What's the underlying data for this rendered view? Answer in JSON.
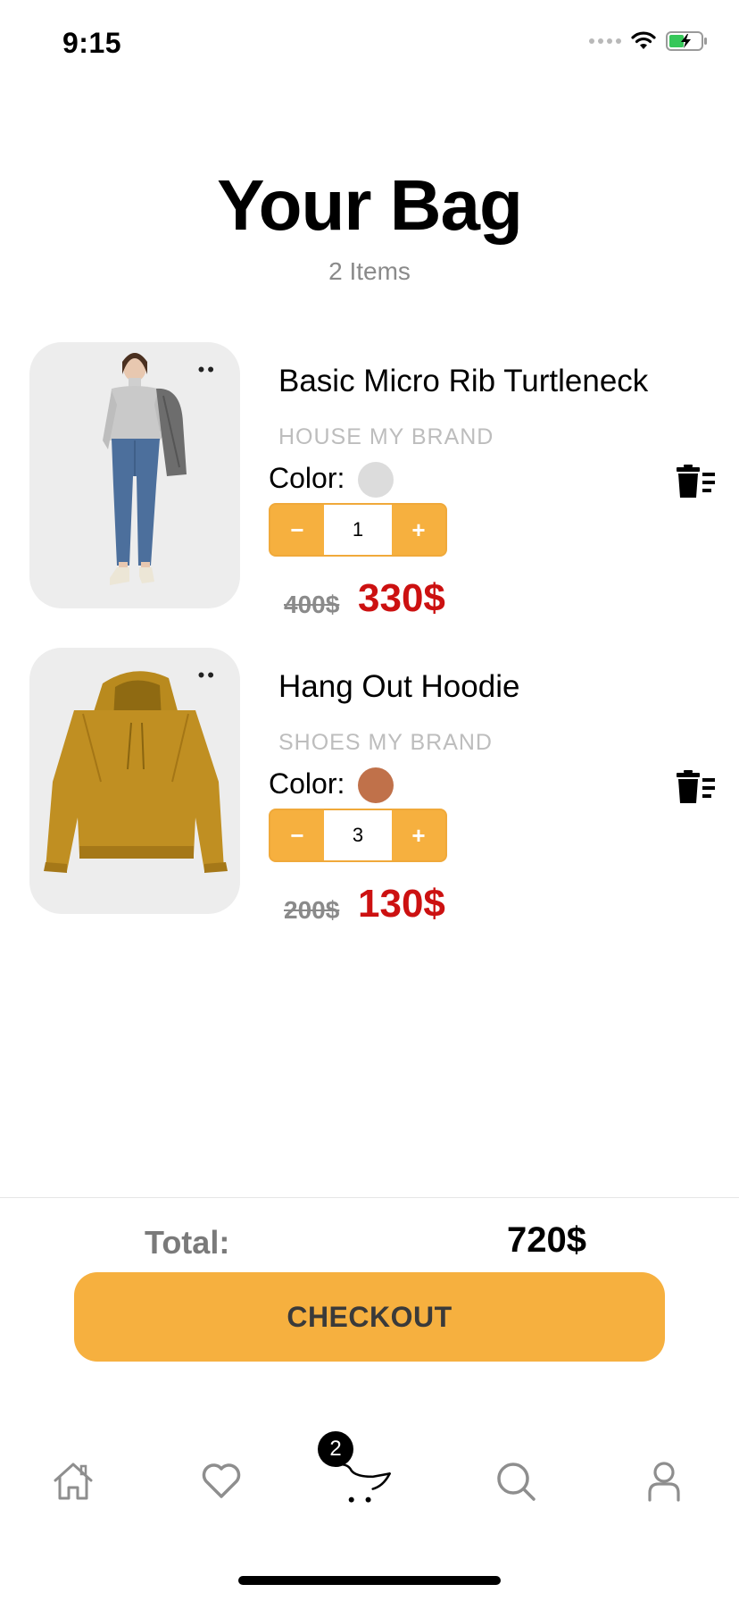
{
  "status_bar": {
    "time": "9:15",
    "icons": [
      "signal-dots-icon",
      "wifi-icon",
      "battery-charging-icon"
    ]
  },
  "header": {
    "title": "Your Bag",
    "subtitle": "2 Items"
  },
  "cart": {
    "items": [
      {
        "name": "Basic Micro Rib Turtleneck",
        "brand": "HOUSE MY BRAND",
        "color_label": "Color:",
        "color_swatch": "#dcdcdc",
        "quantity": "1",
        "decrement_label": "−",
        "increment_label": "+",
        "old_price": "400$",
        "new_price": "330$",
        "menu_icon": "more-dots-icon",
        "delete_icon": "trash-list-icon",
        "image": "woman-in-gray-turtleneck-and-jeans-photo"
      },
      {
        "name": "Hang Out Hoodie",
        "brand": "SHOES MY BRAND",
        "color_label": "Color:",
        "color_swatch": "#c0714a",
        "quantity": "3",
        "decrement_label": "−",
        "increment_label": "+",
        "old_price": "200$",
        "new_price": "130$",
        "menu_icon": "more-dots-icon",
        "delete_icon": "trash-list-icon",
        "image": "mustard-hoodie-photo"
      }
    ]
  },
  "summary": {
    "total_label": "Total:",
    "total_value": "720$",
    "checkout_label": "CHECKOUT"
  },
  "tab_bar": {
    "tabs": [
      {
        "name": "home",
        "icon": "home-icon"
      },
      {
        "name": "favorites",
        "icon": "heart-icon"
      },
      {
        "name": "cart",
        "icon": "cart-icon",
        "badge": "2",
        "active": true
      },
      {
        "name": "search",
        "icon": "search-icon"
      },
      {
        "name": "profile",
        "icon": "user-icon"
      }
    ]
  },
  "colors": {
    "accent": "#f6b03f",
    "price_red": "#cc1111",
    "muted_text": "#8a8a8a",
    "icon_gray": "#8e8e8e"
  }
}
